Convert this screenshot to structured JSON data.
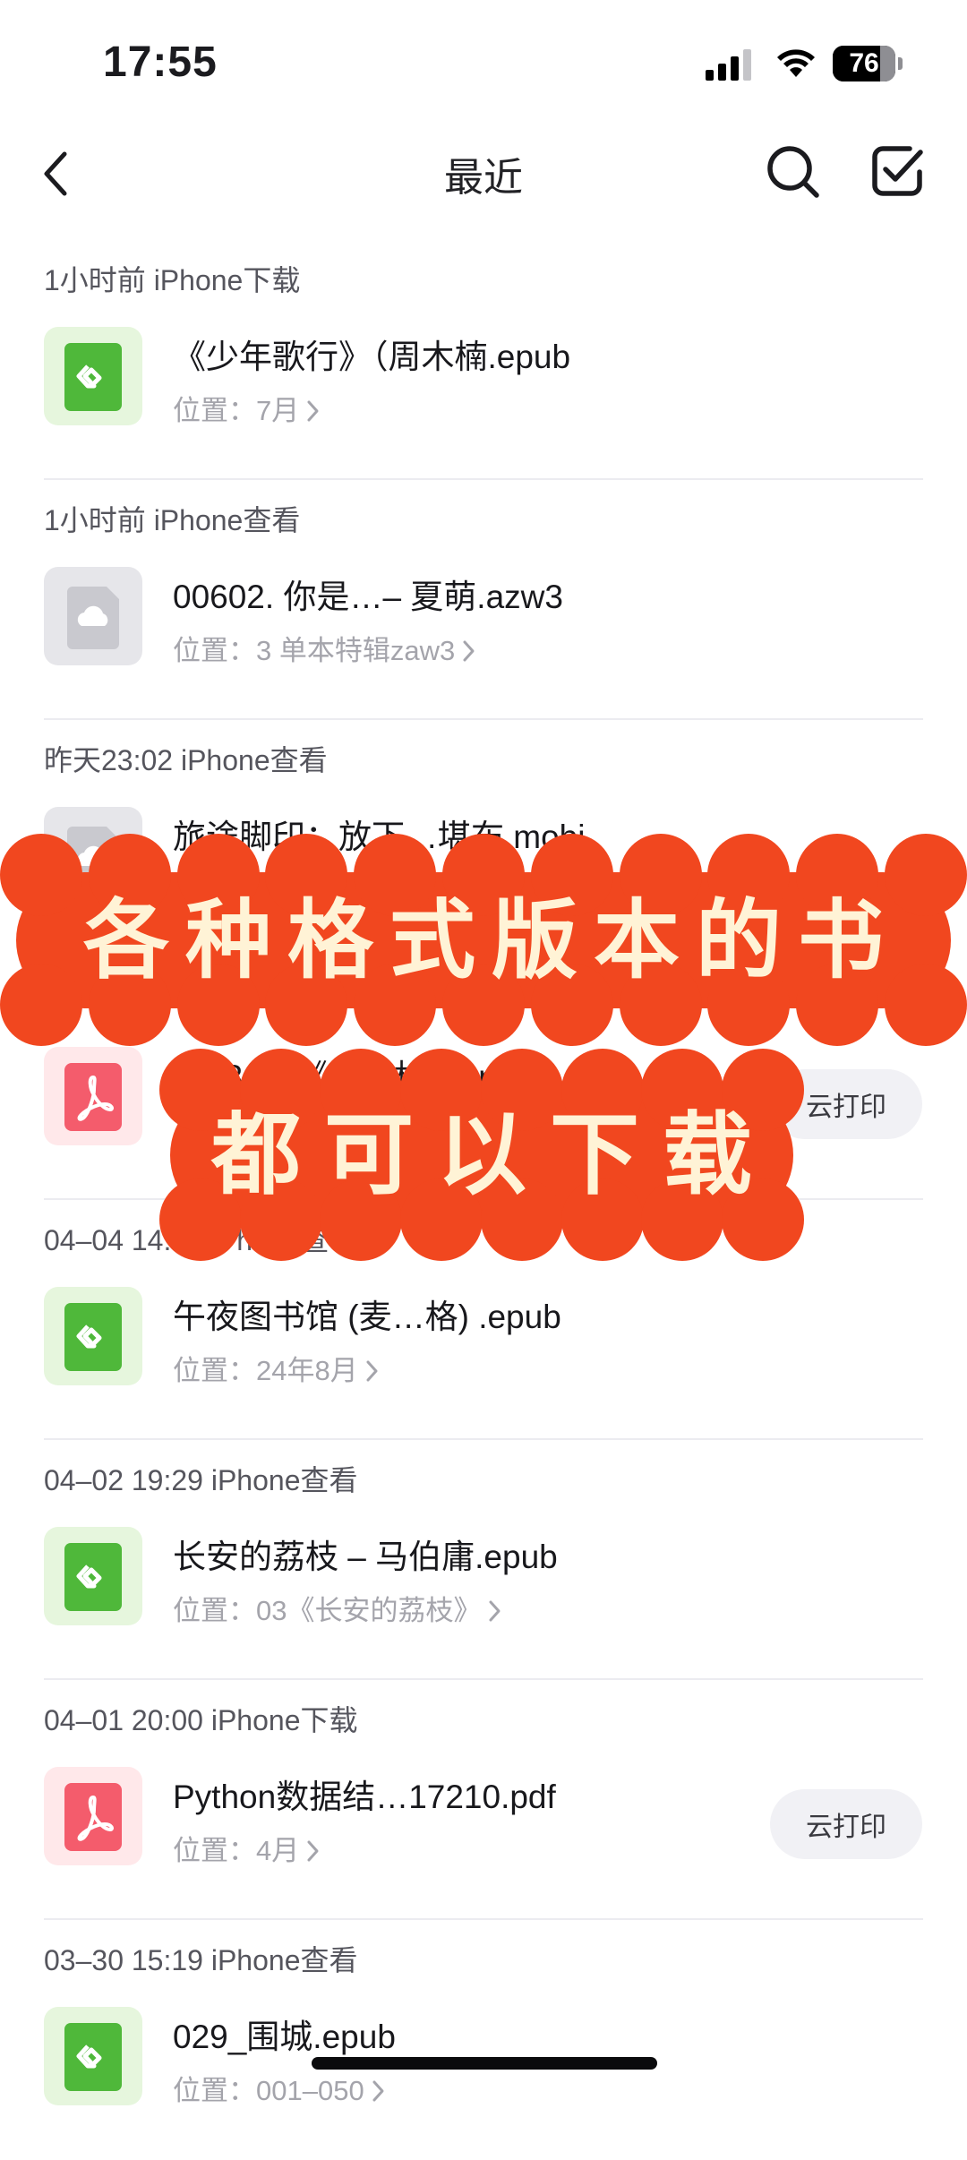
{
  "status_bar": {
    "time": "17:55",
    "battery": "76",
    "battery_level": 0.76,
    "signal_icon": "cellular-signal-icon",
    "wifi_icon": "wifi-icon"
  },
  "nav": {
    "title": "最近",
    "back_icon": "chevron-left-icon",
    "search_icon": "search-icon",
    "select_icon": "checkbox-icon"
  },
  "location_label": "位置：",
  "items": [
    {
      "header": "1小时前 iPhone下载",
      "icon": "epub-icon",
      "name": "《少年歌行》（周木楠.epub",
      "location": "7月",
      "print": ""
    },
    {
      "header": "1小时前 iPhone查看",
      "icon": "cloud-file-icon",
      "name": "00602. 你是…– 夏萌.azw3",
      "location": "3 单本特辑zaw3",
      "print": ""
    },
    {
      "header": "昨天23:02 iPhone查看",
      "icon": "cloud-file-icon",
      "name": "旅途脚印：放下…堪布.mobi",
      "location": "",
      "print": ""
    },
    {
      "header": "",
      "icon": "pdf-icon",
      "name": "第936部《业…格西 .pdf",
      "location": "",
      "print": "云打印"
    },
    {
      "header": "04–04 14:12 iPhone查看",
      "icon": "epub-icon",
      "name": "午夜图书馆 (麦…格) .epub",
      "location": "24年8月",
      "print": ""
    },
    {
      "header": "04–02 19:29 iPhone查看",
      "icon": "epub-icon",
      "name": "长安的荔枝 – 马伯庸.epub",
      "location": "03《长安的荔枝》",
      "print": ""
    },
    {
      "header": "04–01 20:00 iPhone下载",
      "icon": "pdf-icon",
      "name": "Python数据结…17210.pdf",
      "location": "4月",
      "print": "云打印"
    },
    {
      "header": "03–30 15:19 iPhone查看",
      "icon": "epub-icon",
      "name": "029_围城.epub",
      "location": "001–050",
      "print": ""
    }
  ],
  "banner": {
    "line1": "各种格式版本的书",
    "line2": "都可以下载",
    "color": "#f1471f",
    "text_color": "#fff3d6"
  },
  "colors": {
    "epub_green": "#4fb83a",
    "pdf_red": "#f45c6c",
    "cloud_gray": "#c9c9cf"
  }
}
